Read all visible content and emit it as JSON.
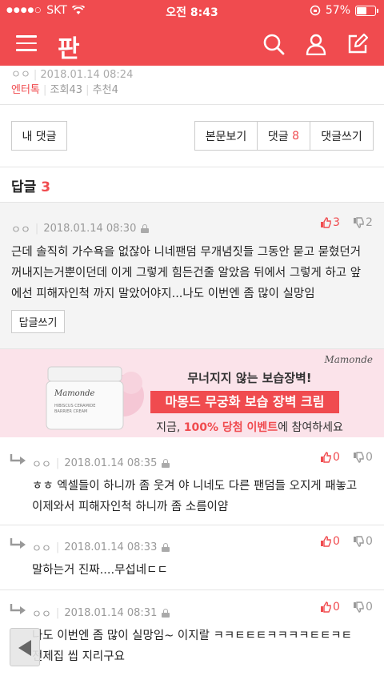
{
  "status": {
    "carrier": "SKT",
    "time": "오전 8:43",
    "battery": "57%",
    "battery_level": 0.57
  },
  "header": {
    "logo": "판"
  },
  "post": {
    "author": "ㅇㅇ",
    "date": "2018.01.14 08:24",
    "category": "엔터톡",
    "views": "조회43",
    "recommends": "추천4"
  },
  "tabs": {
    "my_comments": "내 댓글",
    "view_post": "본문보기",
    "comments": "댓글",
    "comment_count": "8",
    "write_comment": "댓글쓰기"
  },
  "replies_section": {
    "title": "답글",
    "count": "3"
  },
  "best_comment": {
    "author": "ㅇㅇ",
    "date": "2018.01.14 08:30",
    "up": "3",
    "down": "2",
    "lines": [
      "근데 솔직히 가수욕을 없잖아 니네팬덤 무개념짓들 그동안 묻고 묻혔던거",
      "꺼내지는거뿐이던데 이게 그렇게 힘든건줄 알았음 뒤에서 그렇게 하고 앞",
      "에선 피해자인척 까지 말았어야지...나도 이번엔 좀 많이 실망임"
    ],
    "reply_button": "답글쓰기"
  },
  "ad": {
    "brand": "Mamonde",
    "line1": "무너지지 않는 보습장벽!",
    "line2": "마몽드 무궁화 보습 장벽 크림",
    "line3_pre": "지금, ",
    "line3_highlight": "100% 당첨 이벤트",
    "line3_post": "에 참여하세요",
    "jar_brand": "Mamonde",
    "jar_text": "HIBISCUS CERAMIDE\nBARRIER CREAM"
  },
  "replies": [
    {
      "author": "ㅇㅇ",
      "date": "2018.01.14 08:35",
      "up": "0",
      "down": "0",
      "lines": [
        "ㅎㅎ 엑셀들이 하니까 좀 웃겨 야 니네도 다른 팬덤들 오지게 패놓고",
        "이제와서 피해자인척 하니까 좀 소름이얌"
      ]
    },
    {
      "author": "ㅇㅇ",
      "date": "2018.01.14 08:33",
      "up": "0",
      "down": "0",
      "lines": [
        "말하는거 진짜....무섭네ㄷㄷ"
      ]
    },
    {
      "author": "ㅇㅇ",
      "date": "2018.01.14 08:31",
      "up": "0",
      "down": "0",
      "lines": [
        "나도 이번엔 좀 많이 실망임~ 이지랄 ㅋㅋㅌㅌㅌㅋㅋㅋㅋㅌㅌㅋㅌ",
        "전제집 씹 지리구요"
      ]
    }
  ]
}
